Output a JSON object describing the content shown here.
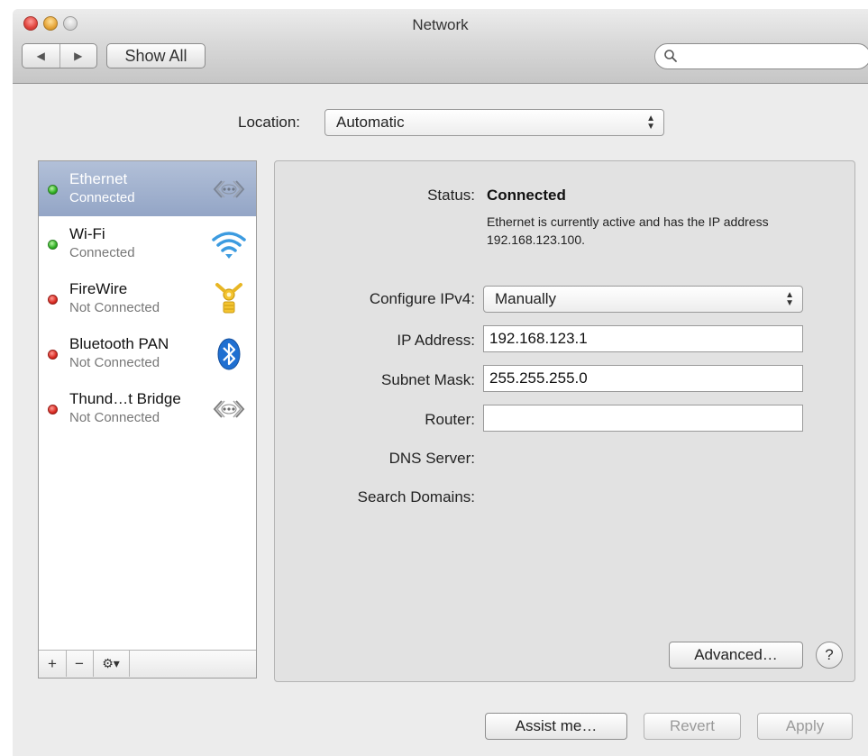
{
  "window": {
    "title": "Network"
  },
  "toolbar": {
    "back_glyph": "◀",
    "forward_glyph": "▶",
    "show_all_label": "Show All",
    "search_value": ""
  },
  "location": {
    "label": "Location:",
    "value": "Automatic"
  },
  "services": [
    {
      "name": "Ethernet",
      "status": "Connected",
      "indicator": "green",
      "icon": "ethernet-icon",
      "selected": true
    },
    {
      "name": "Wi-Fi",
      "status": "Connected",
      "indicator": "green",
      "icon": "wifi-icon",
      "selected": false
    },
    {
      "name": "FireWire",
      "status": "Not Connected",
      "indicator": "red",
      "icon": "firewire-icon",
      "selected": false
    },
    {
      "name": "Bluetooth PAN",
      "status": "Not Connected",
      "indicator": "red",
      "icon": "bluetooth-icon",
      "selected": false
    },
    {
      "name": "Thund…t Bridge",
      "status": "Not Connected",
      "indicator": "red",
      "icon": "thunderbolt-bridge-icon",
      "selected": false
    }
  ],
  "sidebar_footer": {
    "add": "+",
    "remove": "−",
    "action": "⚙▾"
  },
  "details": {
    "status_label": "Status:",
    "status_value": "Connected",
    "status_description": "Ethernet is currently active and has the IP address 192.168.123.100.",
    "configure_label": "Configure IPv4:",
    "configure_value": "Manually",
    "ip_label": "IP Address:",
    "ip_value": "192.168.123.1",
    "subnet_label": "Subnet Mask:",
    "subnet_value": "255.255.255.0",
    "router_label": "Router:",
    "router_value": "",
    "dns_label": "DNS Server:",
    "search_domains_label": "Search Domains:",
    "advanced_label": "Advanced…",
    "help_label": "?"
  },
  "bottom_buttons": {
    "assist": "Assist me…",
    "revert": "Revert",
    "apply": "Apply"
  },
  "colors": {
    "connected": "#2fb023",
    "not_connected": "#d92a22",
    "selection": "#a3b3cf"
  }
}
